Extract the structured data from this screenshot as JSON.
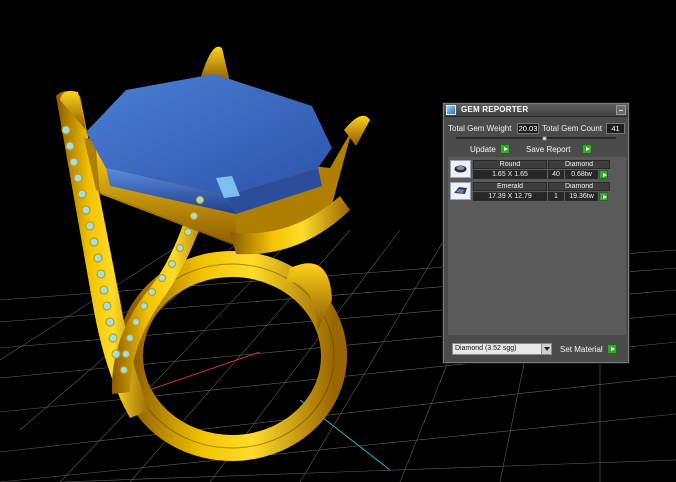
{
  "window": {
    "title": "GEM REPORTER"
  },
  "totals": {
    "weight_label": "Total Gem Weight",
    "weight_value": "20.03",
    "count_label": "Total Gem Count",
    "count_value": "41"
  },
  "slider": {
    "value": 0.55
  },
  "actions": {
    "update_label": "Update",
    "save_report_label": "Save Report"
  },
  "gems": [
    {
      "shape": "Round",
      "size": "1.65 X 1.65",
      "material": "Diamond",
      "count": "40",
      "weight": "0.68tw",
      "thumb_icon": "round-gem-icon"
    },
    {
      "shape": "Emerald",
      "size": "17.39 X 12.79",
      "material": "Diamond",
      "count": "1",
      "weight": "19.36tw",
      "thumb_icon": "emerald-gem-icon"
    }
  ],
  "material_bar": {
    "selected": "Diamond     (3.52 sgg)",
    "set_label": "Set Material"
  },
  "colors": {
    "stone": "#3a67c4",
    "metal": "#e8b400",
    "panel": "#4b4b4b",
    "go_button": "#3aa535",
    "grid": "#7a7a7a"
  }
}
